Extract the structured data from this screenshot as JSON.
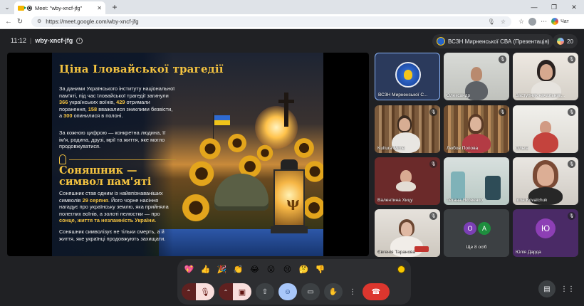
{
  "browser": {
    "tab_title": "Meet: \"wby-xncf-jfg\"",
    "url": "https://meet.google.com/wby-xncf-jfg",
    "chat_label": "Чат"
  },
  "meet": {
    "time": "11:12",
    "separator": "|",
    "code": "wby-xncf-jfg",
    "presenter_chip": "ВСЗН Мирненської СВА (Презентація)",
    "participant_count": "20"
  },
  "slide": {
    "title": "Ціна Іловайської трагедії",
    "p1_a": "За даними Українського інституту національної пам'яті, під час Іловайської трагедії загинули ",
    "p1_n1": "366",
    "p1_b": " українських воїнів, ",
    "p1_n2": "429",
    "p1_c": " отримали поранення, ",
    "p1_n3": "158",
    "p1_d": " вважалися зниклими безвісти, а ",
    "p1_n4": "300",
    "p1_e": " опинилися в полоні.",
    "p2": "За кожною цифрою — конкретна людина, її ім'я, родина, друзі, мрії та життя, яке могло продовжуватися.",
    "h2_line1": "Соняшник —",
    "h2_line2": "символ пам'яті",
    "p3_a": "Соняшник став одним із найвпізнаваніших символів ",
    "p3_date": "29 серпня",
    "p3_b": ". Його чорне насіння нагадує про українську землю, яка прийняла полеглих воїнів, а золоті пелюстки — про ",
    "p3_hl": "сонце, життя та незламність України.",
    "p4": "Соняшник символізує не тільки смерть, а й життя, яке українці продовжують захищати."
  },
  "tiles": [
    {
      "name": "ВСЗН Мирненської С..."
    },
    {
      "name": "Олександр"
    },
    {
      "name": "Заступник начальник..."
    },
    {
      "name": "Kultura Mirne"
    },
    {
      "name": "Любов Попова"
    },
    {
      "name": "Ольга"
    },
    {
      "name": "Валентина Хицу"
    },
    {
      "name": "Тетяна Яковенко"
    },
    {
      "name": "Inna Kovalchuk"
    },
    {
      "name": "Євгенія Таранова"
    },
    {
      "name": "Ще 8 осіб",
      "initials": [
        "O",
        "A"
      ]
    },
    {
      "name": "Юлія Дарда",
      "initial": "Ю"
    }
  ],
  "reactions": [
    "💖",
    "👍",
    "🎉",
    "👏",
    "😂",
    "😮",
    "😢",
    "🤔",
    "👎"
  ],
  "colors": {
    "accent": "#a8c7fa",
    "leave": "#dc362e",
    "muted_bg": "#f9dedc",
    "slide_gold": "#f4c340",
    "avatar_o": "#7b3fb5",
    "avatar_a": "#1e8e3e",
    "avatar_yu": "#8d3fb5"
  }
}
